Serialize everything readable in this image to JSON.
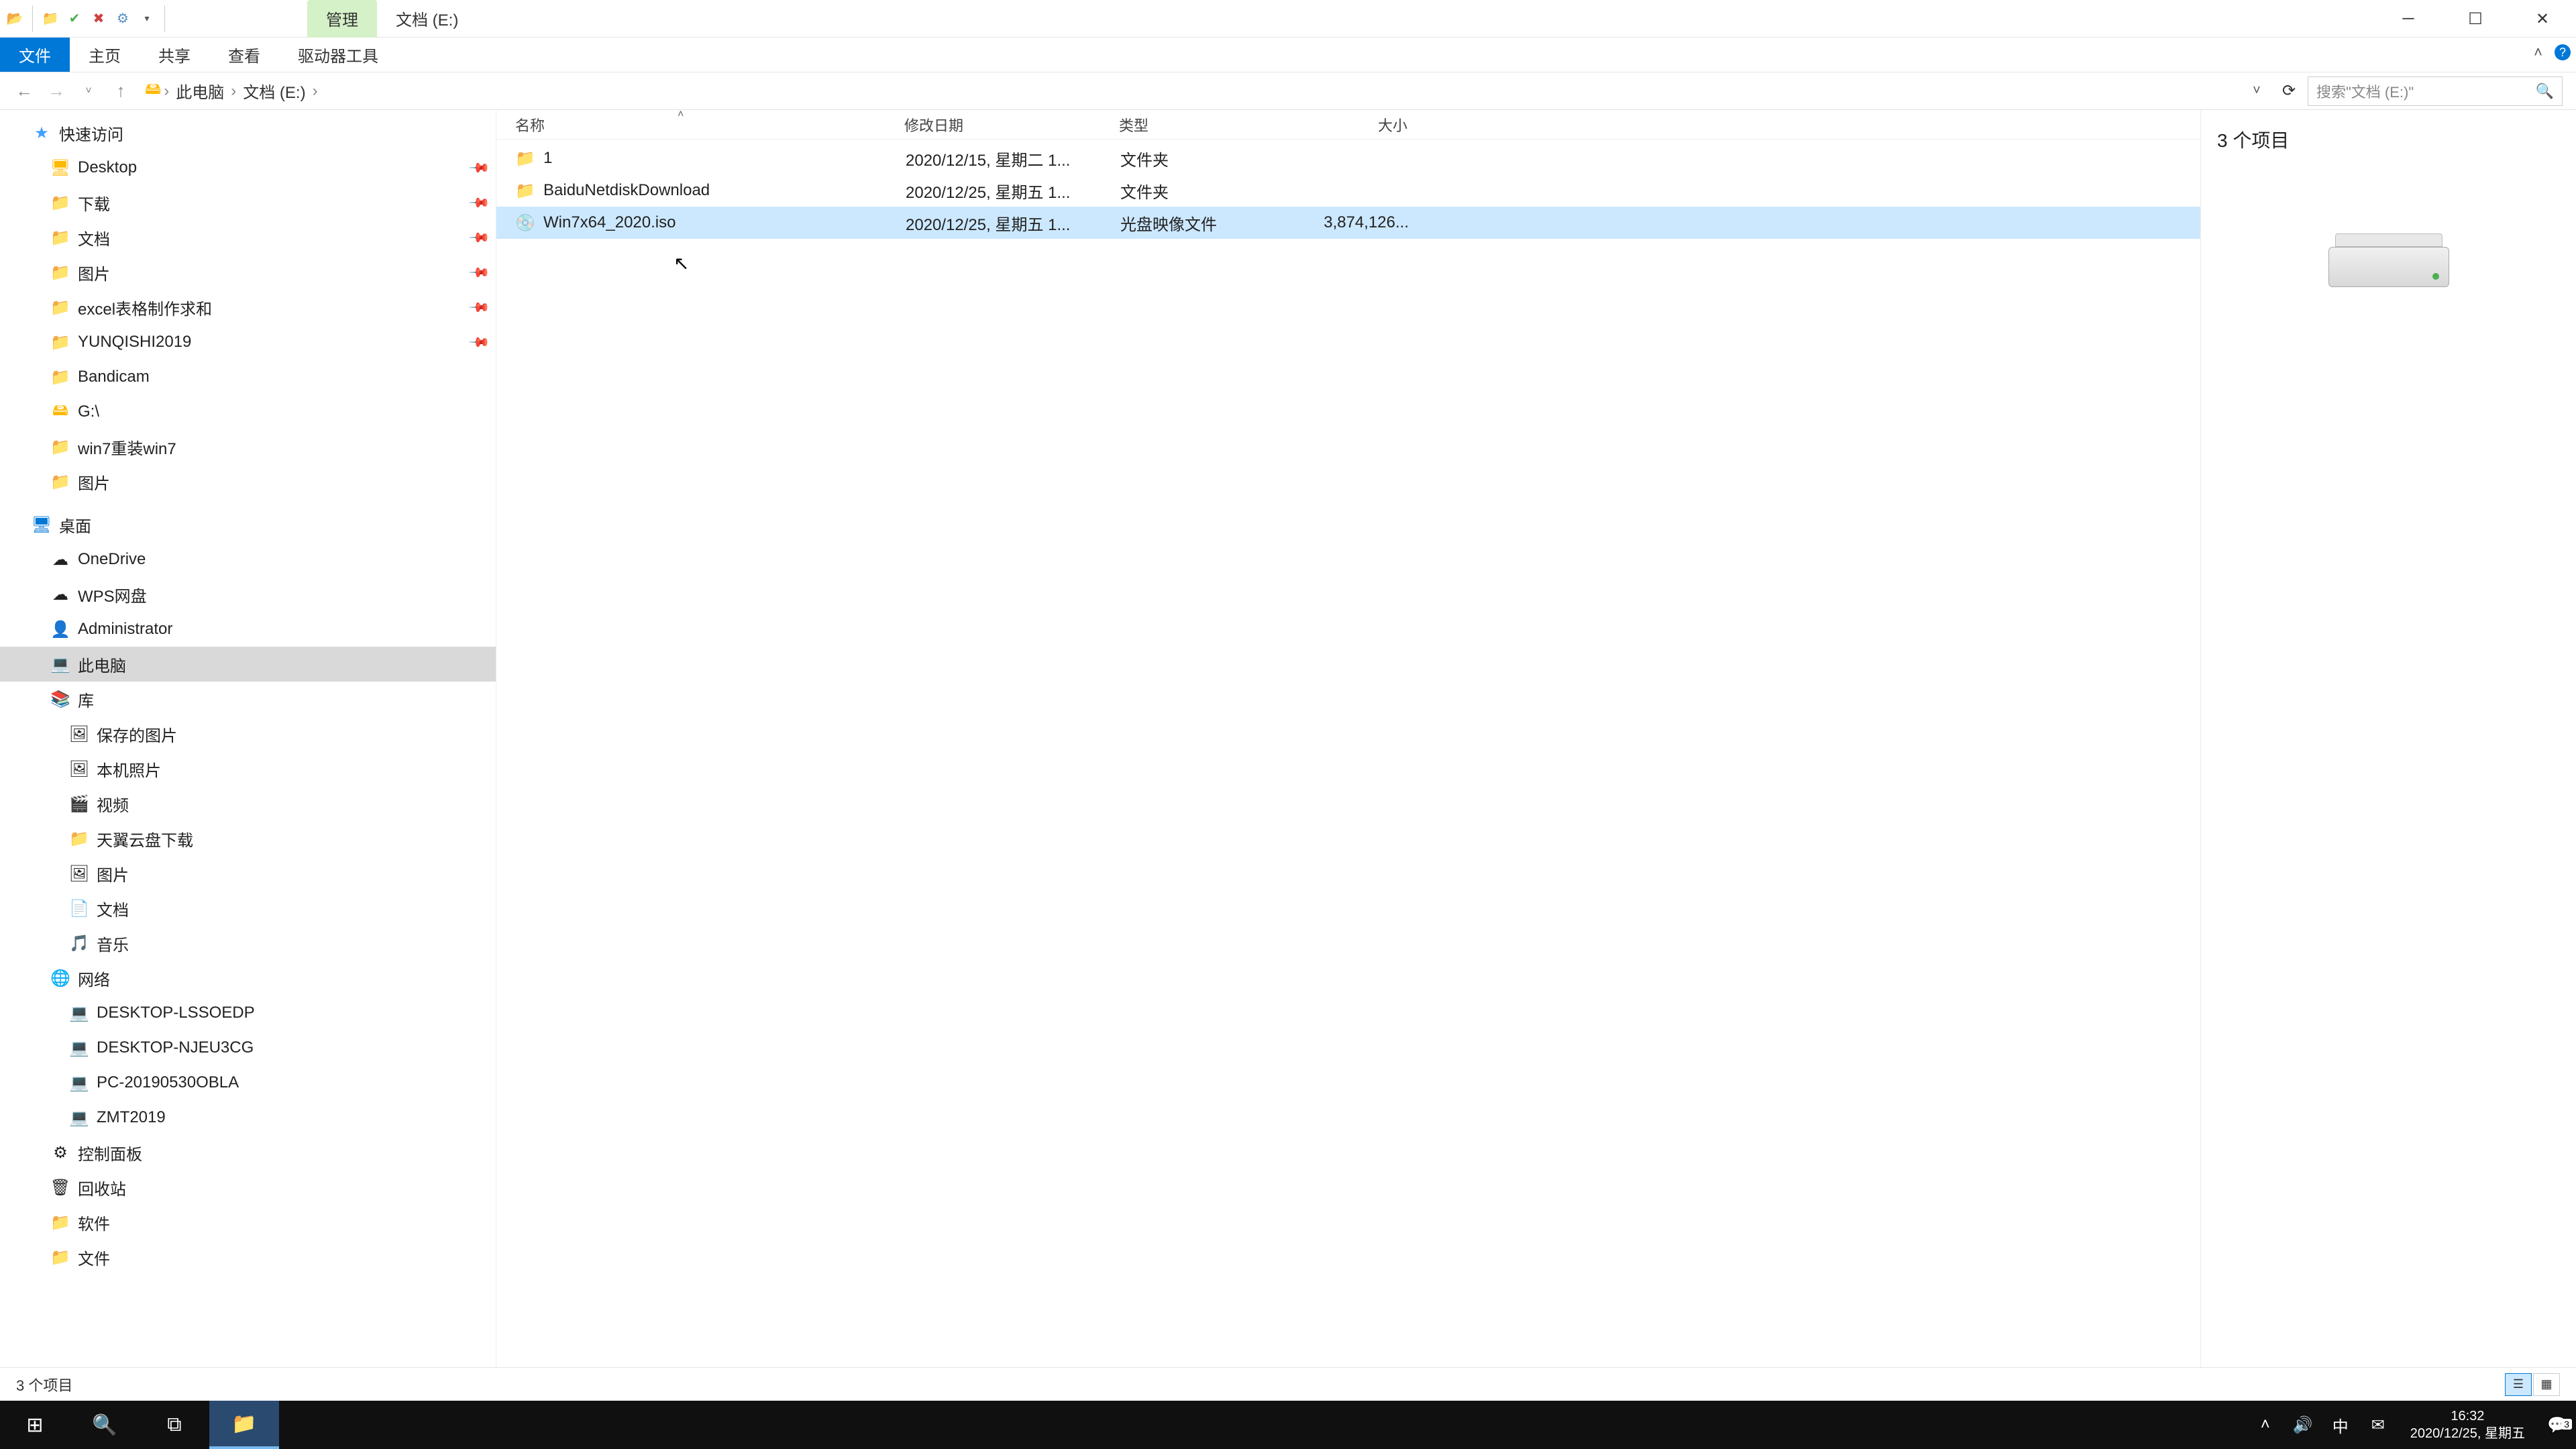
{
  "titlebar": {
    "contextual_tab": "管理",
    "window_title": "文档 (E:)"
  },
  "ribbon": {
    "file": "文件",
    "home": "主页",
    "share": "共享",
    "view": "查看",
    "drive_tools": "驱动器工具"
  },
  "address": {
    "crumbs": [
      "此电脑",
      "文档 (E:)"
    ]
  },
  "search": {
    "placeholder": "搜索\"文档 (E:)\""
  },
  "sidebar": {
    "quick_access": "快速访问",
    "quick_items": [
      {
        "label": "Desktop",
        "icon": "desktop",
        "pinned": true,
        "indent": 76
      },
      {
        "label": "下载",
        "icon": "folder",
        "pinned": true,
        "indent": 76
      },
      {
        "label": "文档",
        "icon": "folder",
        "pinned": true,
        "indent": 76
      },
      {
        "label": "图片",
        "icon": "folder",
        "pinned": true,
        "indent": 76
      },
      {
        "label": "excel表格制作求和",
        "icon": "folder",
        "pinned": true,
        "indent": 76
      },
      {
        "label": "YUNQISHI2019",
        "icon": "folder",
        "pinned": true,
        "indent": 76
      },
      {
        "label": "Bandicam",
        "icon": "folder",
        "pinned": false,
        "indent": 76
      },
      {
        "label": "G:\\",
        "icon": "drive",
        "pinned": false,
        "indent": 76
      },
      {
        "label": "win7重装win7",
        "icon": "folder",
        "pinned": false,
        "indent": 76
      },
      {
        "label": "图片",
        "icon": "folder",
        "pinned": false,
        "indent": 76
      }
    ],
    "desktop_root": "桌面",
    "desktop_items": [
      {
        "label": "OneDrive",
        "icon": "cloud",
        "indent": 76
      },
      {
        "label": "WPS网盘",
        "icon": "cloud",
        "indent": 76
      },
      {
        "label": "Administrator",
        "icon": "user",
        "indent": 76
      },
      {
        "label": "此电脑",
        "icon": "pc",
        "indent": 76,
        "selected": true
      },
      {
        "label": "库",
        "icon": "lib",
        "indent": 76
      },
      {
        "label": "保存的图片",
        "icon": "pic",
        "indent": 104
      },
      {
        "label": "本机照片",
        "icon": "pic",
        "indent": 104
      },
      {
        "label": "视频",
        "icon": "vid",
        "indent": 104
      },
      {
        "label": "天翼云盘下载",
        "icon": "folder",
        "indent": 104
      },
      {
        "label": "图片",
        "icon": "pic",
        "indent": 104
      },
      {
        "label": "文档",
        "icon": "doc",
        "indent": 104
      },
      {
        "label": "音乐",
        "icon": "music",
        "indent": 104
      },
      {
        "label": "网络",
        "icon": "net",
        "indent": 76
      },
      {
        "label": "DESKTOP-LSSOEDP",
        "icon": "monitor",
        "indent": 104
      },
      {
        "label": "DESKTOP-NJEU3CG",
        "icon": "monitor",
        "indent": 104
      },
      {
        "label": "PC-20190530OBLA",
        "icon": "monitor",
        "indent": 104
      },
      {
        "label": "ZMT2019",
        "icon": "monitor",
        "indent": 104
      },
      {
        "label": "控制面板",
        "icon": "cp",
        "indent": 76
      },
      {
        "label": "回收站",
        "icon": "recycle",
        "indent": 76
      },
      {
        "label": "软件",
        "icon": "folder",
        "indent": 76
      },
      {
        "label": "文件",
        "icon": "folder",
        "indent": 76
      }
    ]
  },
  "columns": {
    "name": "名称",
    "date": "修改日期",
    "type": "类型",
    "size": "大小"
  },
  "files": [
    {
      "name": "1",
      "date": "2020/12/15, 星期二 1...",
      "type": "文件夹",
      "size": "",
      "icon": "folder",
      "selected": false
    },
    {
      "name": "BaiduNetdiskDownload",
      "date": "2020/12/25, 星期五 1...",
      "type": "文件夹",
      "size": "",
      "icon": "folder",
      "selected": false
    },
    {
      "name": "Win7x64_2020.iso",
      "date": "2020/12/25, 星期五 1...",
      "type": "光盘映像文件",
      "size": "3,874,126...",
      "icon": "iso",
      "selected": true
    }
  ],
  "preview": {
    "title": "3 个项目"
  },
  "status": {
    "text": "3 个项目"
  },
  "taskbar": {
    "time": "16:32",
    "date": "2020/12/25, 星期五",
    "ime": "中",
    "notif_count": "3"
  }
}
